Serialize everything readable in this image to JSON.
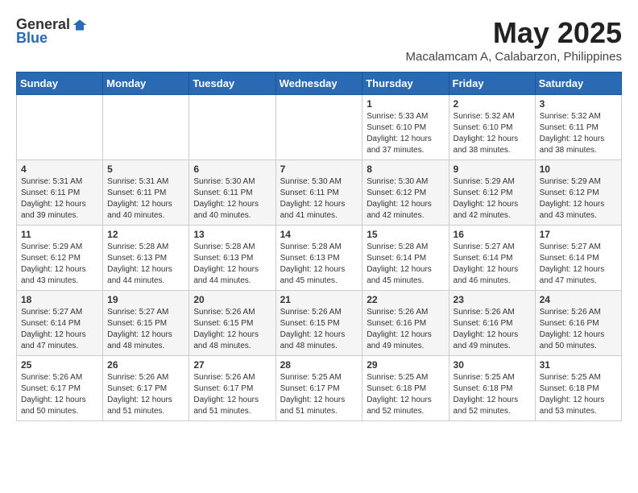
{
  "logo": {
    "general": "General",
    "blue": "Blue"
  },
  "header": {
    "month": "May 2025",
    "location": "Macalamcam A, Calabarzon, Philippines"
  },
  "days_of_week": [
    "Sunday",
    "Monday",
    "Tuesday",
    "Wednesday",
    "Thursday",
    "Friday",
    "Saturday"
  ],
  "weeks": [
    [
      {
        "day": "",
        "info": ""
      },
      {
        "day": "",
        "info": ""
      },
      {
        "day": "",
        "info": ""
      },
      {
        "day": "",
        "info": ""
      },
      {
        "day": "1",
        "info": "Sunrise: 5:33 AM\nSunset: 6:10 PM\nDaylight: 12 hours\nand 37 minutes."
      },
      {
        "day": "2",
        "info": "Sunrise: 5:32 AM\nSunset: 6:10 PM\nDaylight: 12 hours\nand 38 minutes."
      },
      {
        "day": "3",
        "info": "Sunrise: 5:32 AM\nSunset: 6:11 PM\nDaylight: 12 hours\nand 38 minutes."
      }
    ],
    [
      {
        "day": "4",
        "info": "Sunrise: 5:31 AM\nSunset: 6:11 PM\nDaylight: 12 hours\nand 39 minutes."
      },
      {
        "day": "5",
        "info": "Sunrise: 5:31 AM\nSunset: 6:11 PM\nDaylight: 12 hours\nand 40 minutes."
      },
      {
        "day": "6",
        "info": "Sunrise: 5:30 AM\nSunset: 6:11 PM\nDaylight: 12 hours\nand 40 minutes."
      },
      {
        "day": "7",
        "info": "Sunrise: 5:30 AM\nSunset: 6:11 PM\nDaylight: 12 hours\nand 41 minutes."
      },
      {
        "day": "8",
        "info": "Sunrise: 5:30 AM\nSunset: 6:12 PM\nDaylight: 12 hours\nand 42 minutes."
      },
      {
        "day": "9",
        "info": "Sunrise: 5:29 AM\nSunset: 6:12 PM\nDaylight: 12 hours\nand 42 minutes."
      },
      {
        "day": "10",
        "info": "Sunrise: 5:29 AM\nSunset: 6:12 PM\nDaylight: 12 hours\nand 43 minutes."
      }
    ],
    [
      {
        "day": "11",
        "info": "Sunrise: 5:29 AM\nSunset: 6:12 PM\nDaylight: 12 hours\nand 43 minutes."
      },
      {
        "day": "12",
        "info": "Sunrise: 5:28 AM\nSunset: 6:13 PM\nDaylight: 12 hours\nand 44 minutes."
      },
      {
        "day": "13",
        "info": "Sunrise: 5:28 AM\nSunset: 6:13 PM\nDaylight: 12 hours\nand 44 minutes."
      },
      {
        "day": "14",
        "info": "Sunrise: 5:28 AM\nSunset: 6:13 PM\nDaylight: 12 hours\nand 45 minutes."
      },
      {
        "day": "15",
        "info": "Sunrise: 5:28 AM\nSunset: 6:14 PM\nDaylight: 12 hours\nand 45 minutes."
      },
      {
        "day": "16",
        "info": "Sunrise: 5:27 AM\nSunset: 6:14 PM\nDaylight: 12 hours\nand 46 minutes."
      },
      {
        "day": "17",
        "info": "Sunrise: 5:27 AM\nSunset: 6:14 PM\nDaylight: 12 hours\nand 47 minutes."
      }
    ],
    [
      {
        "day": "18",
        "info": "Sunrise: 5:27 AM\nSunset: 6:14 PM\nDaylight: 12 hours\nand 47 minutes."
      },
      {
        "day": "19",
        "info": "Sunrise: 5:27 AM\nSunset: 6:15 PM\nDaylight: 12 hours\nand 48 minutes."
      },
      {
        "day": "20",
        "info": "Sunrise: 5:26 AM\nSunset: 6:15 PM\nDaylight: 12 hours\nand 48 minutes."
      },
      {
        "day": "21",
        "info": "Sunrise: 5:26 AM\nSunset: 6:15 PM\nDaylight: 12 hours\nand 48 minutes."
      },
      {
        "day": "22",
        "info": "Sunrise: 5:26 AM\nSunset: 6:16 PM\nDaylight: 12 hours\nand 49 minutes."
      },
      {
        "day": "23",
        "info": "Sunrise: 5:26 AM\nSunset: 6:16 PM\nDaylight: 12 hours\nand 49 minutes."
      },
      {
        "day": "24",
        "info": "Sunrise: 5:26 AM\nSunset: 6:16 PM\nDaylight: 12 hours\nand 50 minutes."
      }
    ],
    [
      {
        "day": "25",
        "info": "Sunrise: 5:26 AM\nSunset: 6:17 PM\nDaylight: 12 hours\nand 50 minutes."
      },
      {
        "day": "26",
        "info": "Sunrise: 5:26 AM\nSunset: 6:17 PM\nDaylight: 12 hours\nand 51 minutes."
      },
      {
        "day": "27",
        "info": "Sunrise: 5:26 AM\nSunset: 6:17 PM\nDaylight: 12 hours\nand 51 minutes."
      },
      {
        "day": "28",
        "info": "Sunrise: 5:25 AM\nSunset: 6:17 PM\nDaylight: 12 hours\nand 51 minutes."
      },
      {
        "day": "29",
        "info": "Sunrise: 5:25 AM\nSunset: 6:18 PM\nDaylight: 12 hours\nand 52 minutes."
      },
      {
        "day": "30",
        "info": "Sunrise: 5:25 AM\nSunset: 6:18 PM\nDaylight: 12 hours\nand 52 minutes."
      },
      {
        "day": "31",
        "info": "Sunrise: 5:25 AM\nSunset: 6:18 PM\nDaylight: 12 hours\nand 53 minutes."
      }
    ]
  ]
}
